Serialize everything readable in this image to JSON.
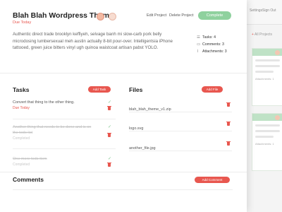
{
  "background": {
    "links": [
      "Settings",
      "Sign Out"
    ],
    "all_projects": "All Projects",
    "attachments_label": "Attachments: 1"
  },
  "header": {
    "title": "Blah Blah Wordpress Theme",
    "due": "Due Today",
    "edit_label": "Edit Project",
    "delete_label": "Delete Project",
    "complete_label": "Complete"
  },
  "description": "Authentic direct trade brooklyn keffiyeh, selvage banh mi slow-carb pork belly microdosing lumbersexual meh austin actually 8-bit pour-over. Intelligentsia iPhone tattooed, green juice bitters vinyl ugh quinoa waistcoat artisan pabst YOLO.",
  "stats": {
    "tasks": "Tasks: 4",
    "comments": "Comments: 3",
    "attachments": "Attachments: 3"
  },
  "tasks": {
    "title": "Tasks",
    "add_label": "Add Task",
    "items": [
      {
        "text": "Convert that thing to the other thing.",
        "status": "Due Today"
      },
      {
        "text": "Another thing that needs to be done and is on the todo list",
        "status": "Completed"
      },
      {
        "text": "One more todo item",
        "status": "Completed"
      }
    ]
  },
  "files": {
    "title": "Files",
    "add_label": "Add File",
    "items": [
      {
        "name": "blah_blah_theme_v1.zip"
      },
      {
        "name": "logo.svg"
      },
      {
        "name": "another_file.jpg"
      }
    ]
  },
  "comments": {
    "title": "Comments",
    "add_label": "Add Comment"
  },
  "colors": {
    "accent_red": "#e8574f",
    "accent_green": "#8fd19e"
  }
}
